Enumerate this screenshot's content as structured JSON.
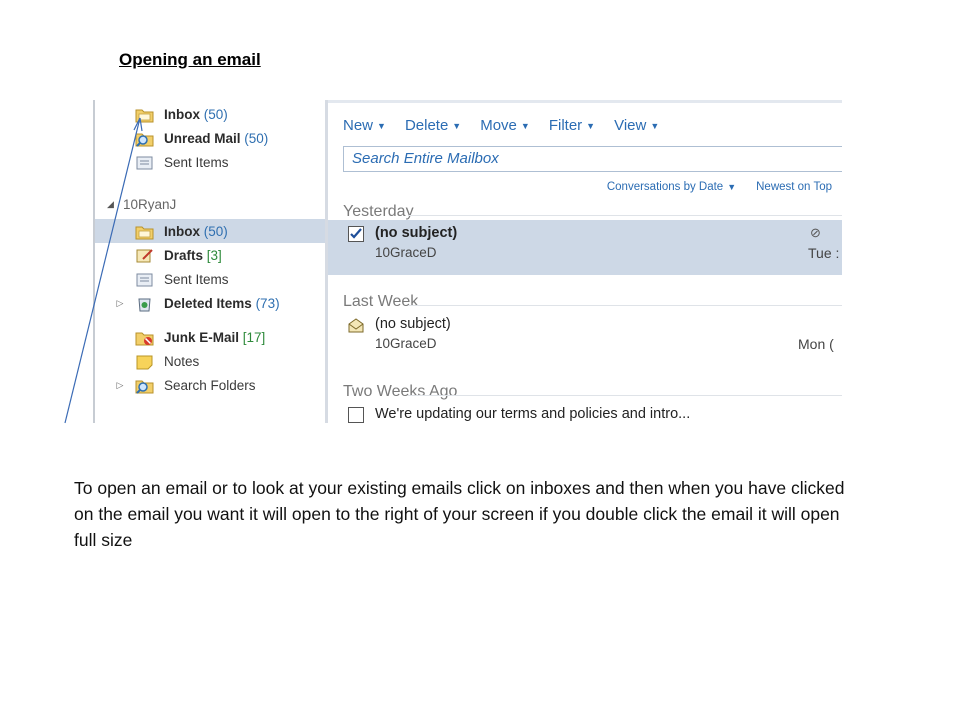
{
  "slide": {
    "title": "Opening an email",
    "body": "To open an email or to look at your existing emails click on inboxes and then when you have clicked on the email you want it will open to the right of your screen if you double click the email it will open full size"
  },
  "folders": {
    "favorites": [
      {
        "label": "Inbox",
        "count": "(50)",
        "icon": "inbox-folder-icon"
      },
      {
        "label": "Unread Mail",
        "count": "(50)",
        "icon": "search-folder-icon"
      },
      {
        "label": "Sent Items",
        "count": "",
        "icon": "sent-items-icon"
      }
    ],
    "account_name": "10RyanJ",
    "account_folders": [
      {
        "label": "Inbox",
        "count": "(50)",
        "icon": "inbox-folder-icon",
        "selected": true
      },
      {
        "label": "Drafts",
        "count": "[3]",
        "icon": "drafts-icon"
      },
      {
        "label": "Sent Items",
        "count": "",
        "icon": "sent-items-icon"
      },
      {
        "label": "Deleted Items",
        "count": "(73)",
        "icon": "deleted-items-icon"
      },
      {
        "label": "Junk E-Mail",
        "count": "[17]",
        "icon": "junk-mail-icon"
      },
      {
        "label": "Notes",
        "count": "",
        "icon": "notes-icon"
      },
      {
        "label": "Search Folders",
        "count": "",
        "icon": "search-folder-icon"
      }
    ]
  },
  "toolbar": {
    "new": "New",
    "delete": "Delete",
    "move": "Move",
    "filter": "Filter",
    "view": "View"
  },
  "search": {
    "placeholder": "Search Entire Mailbox"
  },
  "sort": {
    "by": "Conversations by Date",
    "order": "Newest on Top"
  },
  "groups": {
    "yesterday": "Yesterday",
    "last_week": "Last Week",
    "two_weeks_ago": "Two Weeks Ago"
  },
  "messages": [
    {
      "subject": "(no subject)",
      "from": "10GraceD",
      "date": "Tue :",
      "selected": true,
      "has_attachment": true
    },
    {
      "subject": "(no subject)",
      "from": "10GraceD",
      "date": "Mon (",
      "selected": false
    },
    {
      "subject": "We're updating our terms and policies and intro...",
      "from": "",
      "date": "",
      "selected": false
    }
  ],
  "colors": {
    "accent": "#2b6cb3",
    "selection": "#cdd8e6",
    "count_blue": "#2f6fb0",
    "count_green": "#2e8a3b"
  }
}
